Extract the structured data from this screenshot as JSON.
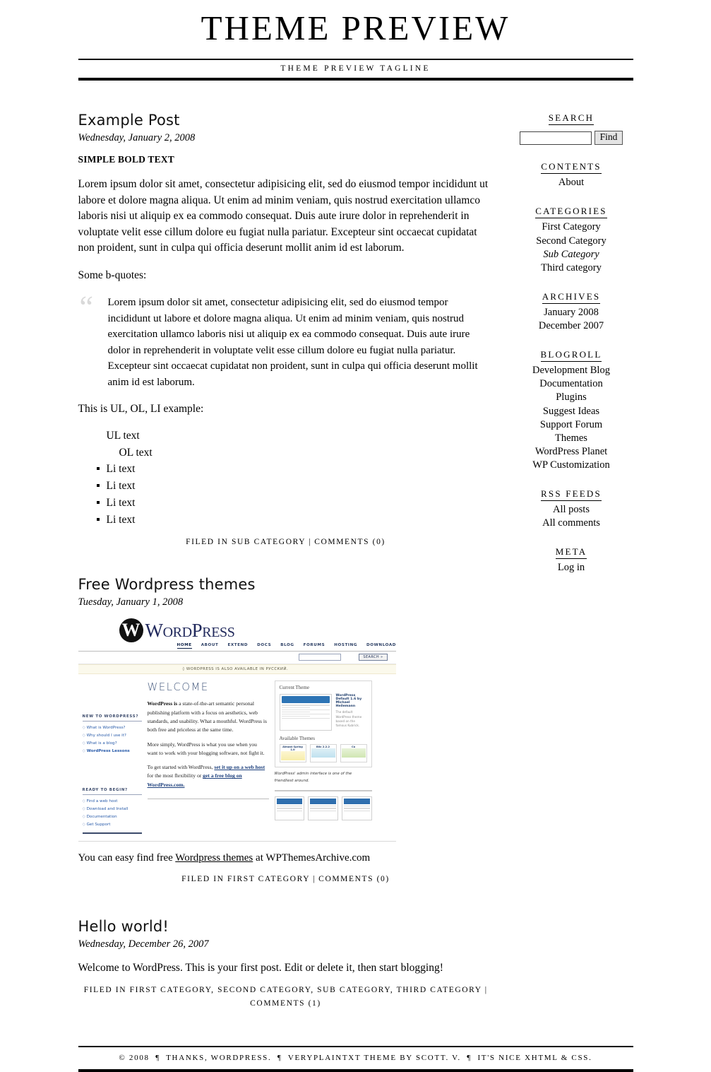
{
  "site": {
    "title": "THEME PREVIEW",
    "tagline": "THEME PREVIEW TAGLINE"
  },
  "posts": [
    {
      "title": "Example Post",
      "date": "Wednesday, January 2, 2008",
      "strong_line": "SIMPLE BOLD TEXT",
      "paragraph1": "Lorem ipsum dolor sit amet, consectetur adipisicing elit, sed do eiusmod tempor incididunt ut labore et dolore magna aliqua. Ut enim ad minim veniam, quis nostrud exercitation ullamco laboris nisi ut aliquip ex ea commodo consequat. Duis aute irure dolor in reprehenderit in voluptate velit esse cillum dolore eu fugiat nulla pariatur. Excepteur sint occaecat cupidatat non proident, sunt in culpa qui officia deserunt mollit anim id est laborum.",
      "quote_intro": "Some b-quotes:",
      "quote_mark": "“",
      "quote_text": "Lorem ipsum dolor sit amet, consectetur adipisicing elit, sed do eiusmod tempor incididunt ut labore et dolore magna aliqua. Ut enim ad minim veniam, quis nostrud exercitation ullamco laboris nisi ut aliquip ex ea commodo consequat. Duis aute irure dolor in reprehenderit in voluptate velit esse cillum dolore eu fugiat nulla pariatur. Excepteur sint occaecat cupidatat non proident, sunt in culpa qui officia deserunt mollit anim id est laborum.",
      "list_intro": "This is UL, OL, LI example:",
      "ul_text": "UL text",
      "ol_text": "OL text",
      "li_items": [
        "Li text",
        "Li text",
        "Li text",
        "Li text"
      ],
      "meta_filed": "FILED IN SUB CATEGORY",
      "meta_sep": "|",
      "meta_comments": "COMMENTS (0)"
    },
    {
      "title": "Free Wordpress themes",
      "date": "Tuesday, January 1, 2008",
      "caption_before": "You can easy find free ",
      "caption_link": "Wordpress themes",
      "caption_after": " at WPThemesArchive.com",
      "meta_filed": "FILED IN FIRST CATEGORY",
      "meta_sep": "|",
      "meta_comments": "COMMENTS (0)"
    },
    {
      "title": "Hello world!",
      "date": "Wednesday, December 26, 2007",
      "body": "Welcome to WordPress. This is your first post. Edit or delete it, then start blogging!",
      "meta_filed": "FILED IN FIRST CATEGORY, SECOND CATEGORY, SUB CATEGORY, THIRD CATEGORY",
      "meta_sep": "|",
      "meta_comments": "COMMENTS (1)"
    }
  ],
  "wp_screenshot": {
    "logo_letter": "W",
    "wordmark_word": "W",
    "wordmark_ord": "ORD",
    "wordmark_p": "P",
    "wordmark_ress": "RESS",
    "nav": [
      "HOME",
      "ABOUT",
      "EXTEND",
      "DOCS",
      "BLOG",
      "FORUMS",
      "HOSTING",
      "DOWNLOAD"
    ],
    "search_button": "SEARCH »",
    "lang_bar": "◊ WORDPRESS IS ALSO AVAILABLE IN РУССКИЙ.",
    "left_box_title": "NEW TO WORDPRESS?",
    "left_links": [
      "What is WordPress?",
      "Why should I use it?",
      "What is a blog?",
      "WordPress Lessons"
    ],
    "left_box2_title": "READY TO BEGIN?",
    "left_links2": [
      "Find a web host",
      "Download and Install",
      "Documentation",
      "Get Support"
    ],
    "welcome": "WELCOME",
    "para1_bold": "WordPress is",
    "para1": " a state-of-the-art semantic personal publishing platform with a focus on aesthetics, web standards, and usability. What a mouthful. WordPress is both free and priceless at the same time.",
    "para2": "More simply, WordPress is what you use when you want to work with your blogging software, not fight it.",
    "para3_before": "To get started with WordPress, ",
    "para3_link1": "set it up on a web host",
    "para3_mid": " for the most flexibility or ",
    "para3_link2": "get a free blog on WordPress.com.",
    "panel_title": "Current Theme",
    "panel_theme_name": "WordPress Default 1.6 by Michael Heilemann",
    "panel_theme_desc": "The default WordPress theme based on the famous Kubrick.",
    "available_title": "Available Themes",
    "themes": [
      "Almost Spring 1.0",
      "Blix 2.2.2",
      "Co"
    ],
    "panel_caption": "WordPress' admin interface is one of the friendliest around."
  },
  "sidebar": {
    "sections": [
      {
        "heading": "SEARCH",
        "type": "search",
        "input_value": "",
        "input_placeholder": "",
        "button_label": "Find"
      },
      {
        "heading": "CONTENTS",
        "type": "list",
        "items": [
          {
            "label": "About",
            "sub": false
          }
        ]
      },
      {
        "heading": "CATEGORIES",
        "type": "list",
        "items": [
          {
            "label": "First Category",
            "sub": false
          },
          {
            "label": "Second Category",
            "sub": false
          },
          {
            "label": "Sub Category",
            "sub": true
          },
          {
            "label": "Third category",
            "sub": false
          }
        ]
      },
      {
        "heading": "ARCHIVES",
        "type": "list",
        "items": [
          {
            "label": "January 2008",
            "sub": false
          },
          {
            "label": "December 2007",
            "sub": false
          }
        ]
      },
      {
        "heading": "BLOGROLL",
        "type": "list",
        "items": [
          {
            "label": "Development Blog",
            "sub": false
          },
          {
            "label": "Documentation",
            "sub": false
          },
          {
            "label": "Plugins",
            "sub": false
          },
          {
            "label": "Suggest Ideas",
            "sub": false
          },
          {
            "label": "Support Forum",
            "sub": false
          },
          {
            "label": "Themes",
            "sub": false
          },
          {
            "label": "WordPress Planet",
            "sub": false
          },
          {
            "label": "WP Customization",
            "sub": false
          }
        ]
      },
      {
        "heading": "RSS FEEDS",
        "type": "list",
        "items": [
          {
            "label": "All posts",
            "sub": false
          },
          {
            "label": "All comments",
            "sub": false
          }
        ]
      },
      {
        "heading": "META",
        "type": "list",
        "items": [
          {
            "label": "Log in",
            "sub": false
          }
        ]
      }
    ]
  },
  "footer": {
    "copyright": "© 2008",
    "pilcrow": "¶",
    "part1": "THANKS, WORDPRESS.",
    "part2": "VERYPLAINTXT THEME BY SCOTT. V.",
    "part3": "IT'S NICE XHTML & CSS."
  }
}
